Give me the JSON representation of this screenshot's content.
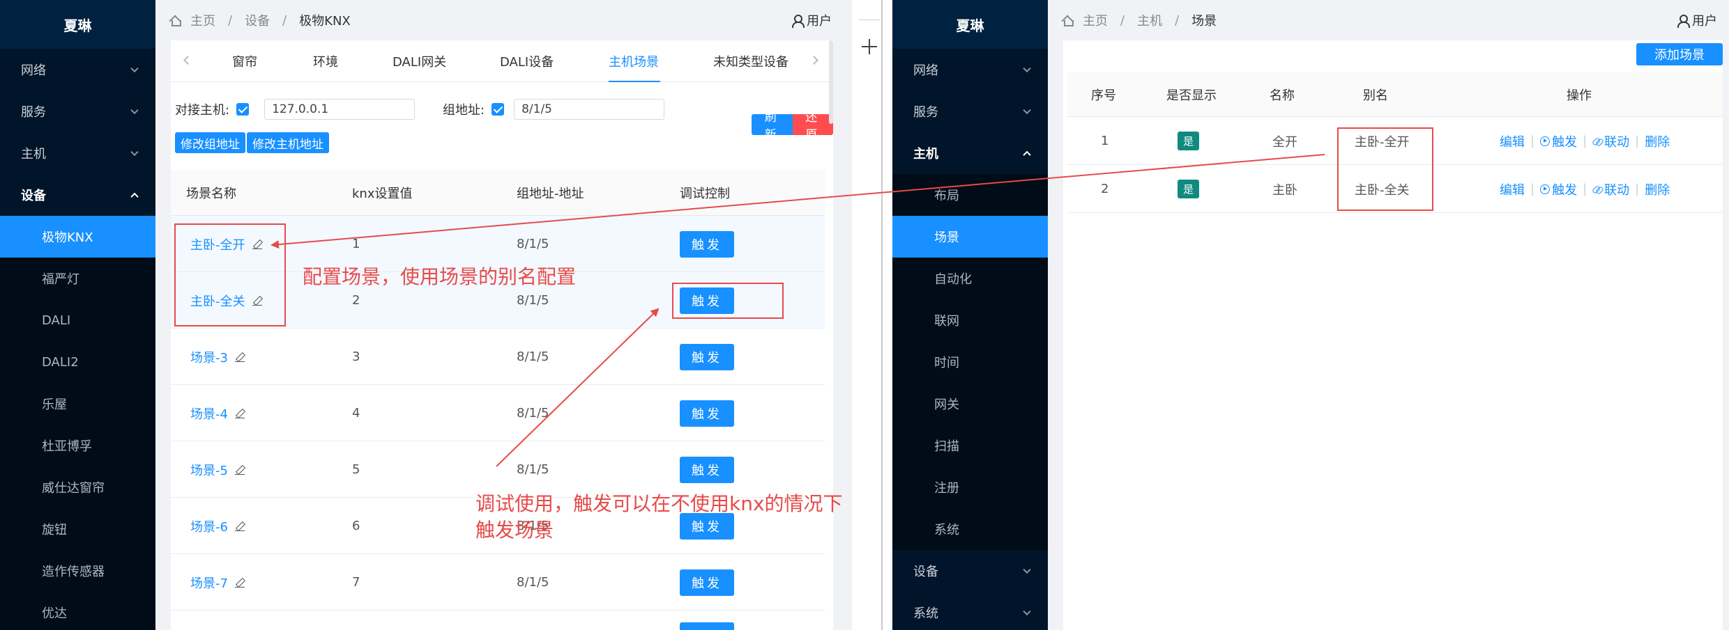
{
  "left": {
    "brand": "夏琳",
    "menu": {
      "network": "网络",
      "service": "服务",
      "host": "主机",
      "device": "设备",
      "sub": [
        "极物KNX",
        "福严灯",
        "DALI",
        "DALI2",
        "乐屋",
        "杜亚博孚",
        "威仕达窗帘",
        "旋钮",
        "造作传感器",
        "优达"
      ]
    },
    "breadcrumb": {
      "home": "主页",
      "sep": "/",
      "level1": "设备",
      "current": "极物KNX"
    },
    "user": "用户",
    "tabs": [
      "窗帘",
      "环境",
      "DALI网关",
      "DALI设备",
      "主机场景",
      "未知类型设备"
    ],
    "form": {
      "host_label": "对接主机:",
      "host_value": "127.0.0.1",
      "group_label": "组地址:",
      "group_value": "8/1/5",
      "btn_modify_group": "修改组地址",
      "btn_modify_host": "修改主机地址",
      "btn_refresh": "刷新",
      "btn_restore": "还原"
    },
    "table": {
      "headers": [
        "场景名称",
        "knx设置值",
        "组地址-地址",
        "调试控制"
      ],
      "trigger_label": "触发",
      "rows": [
        {
          "name": "主卧-全开",
          "value": "1",
          "addr": "8/1/5"
        },
        {
          "name": "主卧-全关",
          "value": "2",
          "addr": "8/1/5"
        },
        {
          "name": "场景-3",
          "value": "3",
          "addr": "8/1/5"
        },
        {
          "name": "场景-4",
          "value": "4",
          "addr": "8/1/5"
        },
        {
          "name": "场景-5",
          "value": "5",
          "addr": "8/1/5"
        },
        {
          "name": "场景-6",
          "value": "6",
          "addr": "8/1/5"
        },
        {
          "name": "场景-7",
          "value": "7",
          "addr": "8/1/5"
        }
      ]
    }
  },
  "right": {
    "brand": "夏琳",
    "menu": {
      "network": "网络",
      "service": "服务",
      "host": "主机",
      "host_sub": [
        "布局",
        "场景",
        "自动化",
        "联网",
        "时间",
        "网关",
        "扫描",
        "注册",
        "系统"
      ],
      "device": "设备",
      "system": "系统"
    },
    "breadcrumb": {
      "home": "主页",
      "sep": "/",
      "level1": "主机",
      "current": "场景"
    },
    "user": "用户",
    "add_button": "添加场景",
    "table": {
      "headers": [
        "序号",
        "是否显示",
        "名称",
        "别名",
        "操作"
      ],
      "ops": {
        "edit": "编辑",
        "trigger": "触发",
        "link": "联动",
        "delete": "删除"
      },
      "rows": [
        {
          "index": "1",
          "show": "是",
          "name": "全开",
          "alias": "主卧-全开"
        },
        {
          "index": "2",
          "show": "是",
          "name": "主卧",
          "alias": "主卧-全关"
        }
      ]
    }
  },
  "annotations": {
    "config_note": "配置场景，使用场景的别名配置",
    "debug_note_line1": "调试使用，触发可以在不使用knx的情况下",
    "debug_note_line2": "触发场景"
  },
  "colors": {
    "sidebar": "#001529",
    "primary": "#1890ff",
    "danger": "#ff4d4f",
    "annotation": "#e84a4a",
    "badge": "#0f8a7e"
  }
}
